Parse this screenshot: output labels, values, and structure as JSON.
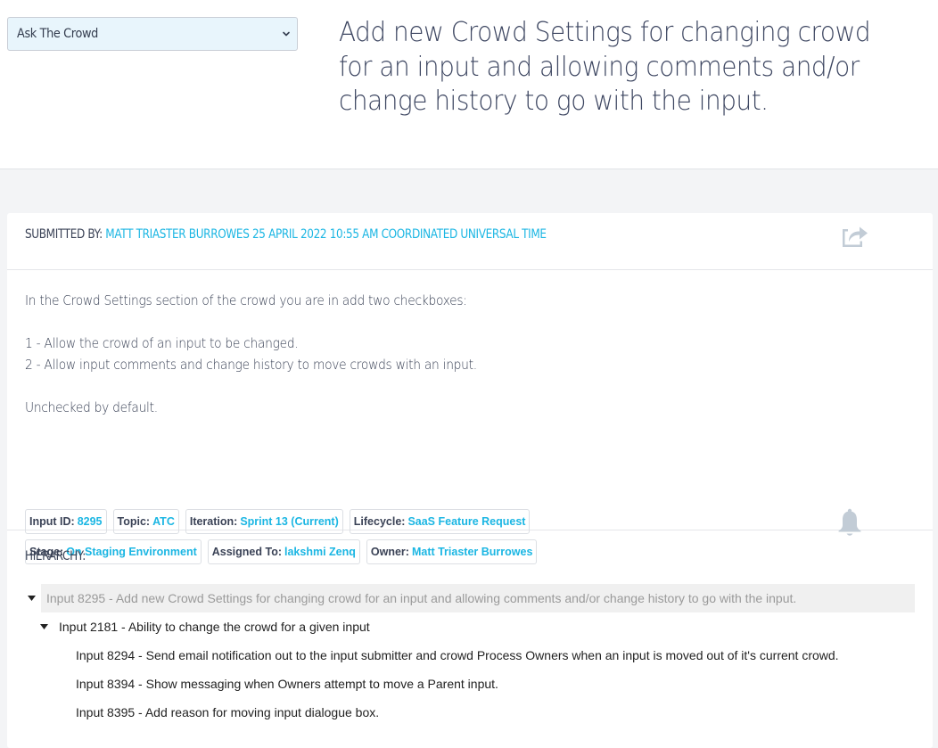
{
  "header": {
    "crowd_select": {
      "selected": "Ask The Crowd"
    },
    "title": "Add new Crowd Settings for changing crowd for an input and allowing comments and/or change history to go with the input."
  },
  "submission": {
    "label": "SUBMITTED BY:",
    "value": "MATT TRIASTER BURROWES 25 APRIL 2022 10:55 AM COORDINATED UNIVERSAL TIME",
    "share_icon": "share-icon"
  },
  "description": {
    "lines": [
      "In the Crowd Settings section of the crowd you are in add two checkboxes:",
      "",
      "1 - Allow the crowd of an input to be changed.",
      "2 - Allow input comments and change history to move crowds with an input.",
      "",
      "Unchecked by default."
    ]
  },
  "tags": [
    {
      "label": "Input ID:",
      "value": "8295"
    },
    {
      "label": "Topic:",
      "value": "ATC"
    },
    {
      "label": "Iteration:",
      "value": "Sprint 13 (Current)"
    },
    {
      "label": "Lifecycle:",
      "value": "SaaS Feature Request"
    },
    {
      "label": "Stage:",
      "value": "On Staging Environment"
    },
    {
      "label": "Assigned To:",
      "value": "lakshmi Zenq"
    },
    {
      "label": "Owner:",
      "value": "Matt Triaster Burrowes"
    }
  ],
  "notification_icon": "bell-icon",
  "hierarchy": {
    "title": "HIERARCHY:",
    "items": [
      {
        "level": 0,
        "expanded": true,
        "selected": true,
        "text": "Input 8295 - Add new Crowd Settings for changing crowd for an input and allowing comments and/or change history to go with the input."
      },
      {
        "level": 1,
        "expanded": true,
        "selected": false,
        "text": "Input 2181 - Ability to change the crowd for a given input"
      },
      {
        "level": 2,
        "expanded": false,
        "selected": false,
        "text": "Input 8294 - Send email notification out to the input submitter and crowd Process Owners when an input is moved out of it's current crowd."
      },
      {
        "level": 2,
        "expanded": false,
        "selected": false,
        "text": "Input 8394 - Show messaging when Owners attempt to move a Parent input."
      },
      {
        "level": 2,
        "expanded": false,
        "selected": false,
        "text": "Input 8395 - Add reason for moving input dialogue box."
      }
    ]
  },
  "colors": {
    "accent": "#1bb6e3",
    "text": "#3a4256",
    "page_bg": "#f3f4f6",
    "icon_gray": "#c2ccd6",
    "selected_row_bg": "#f0f0f0"
  }
}
